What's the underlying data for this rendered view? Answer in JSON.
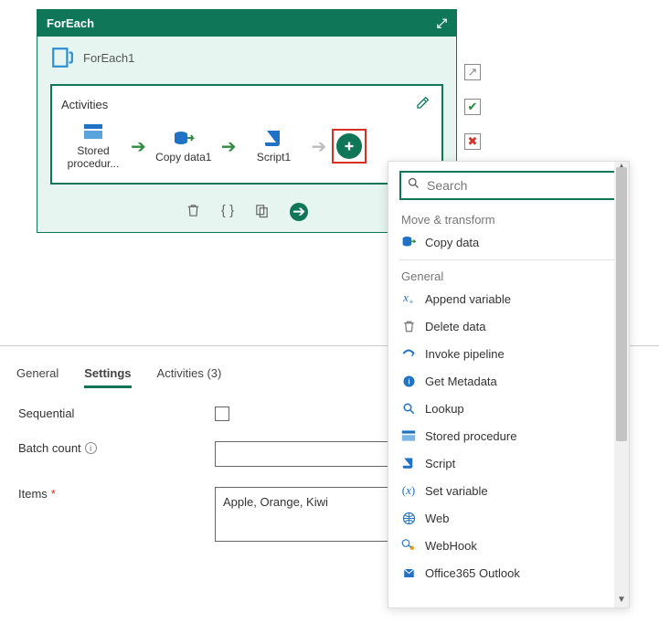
{
  "foreach": {
    "header_title": "ForEach",
    "node_title": "ForEach1",
    "activities_label": "Activities",
    "nodes": [
      {
        "label": "Stored procedur..."
      },
      {
        "label": "Copy data1"
      },
      {
        "label": "Script1"
      }
    ]
  },
  "tabs": {
    "general": "General",
    "settings": "Settings",
    "activities": "Activities (3)"
  },
  "settings": {
    "sequential_label": "Sequential",
    "batch_label": "Batch count",
    "items_label": "Items",
    "batch_value": "",
    "items_value": "Apple, Orange, Kiwi"
  },
  "dropdown": {
    "search_placeholder": "Search",
    "groups": [
      {
        "label": "Move & transform",
        "items": [
          {
            "name": "Copy data",
            "icon": "copy",
            "color": "#1f72c4"
          }
        ]
      },
      {
        "label": "General",
        "items": [
          {
            "name": "Append variable",
            "icon": "xplus",
            "color": "#1f72c4"
          },
          {
            "name": "Delete data",
            "icon": "trash",
            "color": "#777"
          },
          {
            "name": "Invoke pipeline",
            "icon": "pipe",
            "color": "#1f72c4"
          },
          {
            "name": "Get Metadata",
            "icon": "info",
            "color": "#1f72c4"
          },
          {
            "name": "Lookup",
            "icon": "search",
            "color": "#1f72c4"
          },
          {
            "name": "Stored procedure",
            "icon": "sp",
            "color": "#1f72c4"
          },
          {
            "name": "Script",
            "icon": "script",
            "color": "#1f72c4"
          },
          {
            "name": "Set variable",
            "icon": "setvar",
            "color": "#1f72c4"
          },
          {
            "name": "Web",
            "icon": "web",
            "color": "#1f72c4"
          },
          {
            "name": "WebHook",
            "icon": "hook",
            "color": "#1f72c4"
          },
          {
            "name": "Office365 Outlook",
            "icon": "o365",
            "color": "#1f72c4"
          }
        ]
      }
    ]
  }
}
